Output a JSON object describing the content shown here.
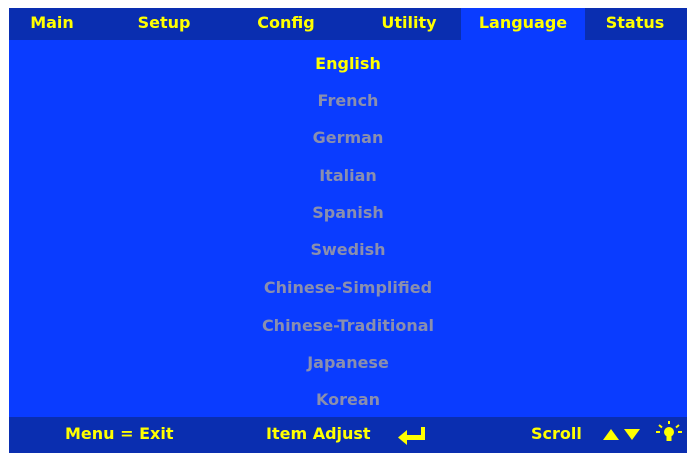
{
  "colors": {
    "panel": "#0a3cff",
    "bar": "#0a2eb0",
    "accent": "#ffff00",
    "inactive": "#8a8fae"
  },
  "tabs": [
    {
      "label": "Main"
    },
    {
      "label": "Setup"
    },
    {
      "label": "Config"
    },
    {
      "label": "Utility"
    },
    {
      "label": "Language"
    },
    {
      "label": "Status"
    }
  ],
  "active_tab": "Language",
  "languages": [
    {
      "label": "English"
    },
    {
      "label": "French"
    },
    {
      "label": "German"
    },
    {
      "label": "Italian"
    },
    {
      "label": "Spanish"
    },
    {
      "label": "Swedish"
    },
    {
      "label": "Chinese-Simplified"
    },
    {
      "label": "Chinese-Traditional"
    },
    {
      "label": "Japanese"
    },
    {
      "label": "Korean"
    }
  ],
  "selected_language": "English",
  "footer": {
    "exit_hint": "Menu = Exit",
    "adjust_hint": "Item Adjust",
    "scroll_hint": "Scroll",
    "icons": [
      "enter-arrow-icon",
      "up-down-arrows-icon",
      "lamp-icon"
    ]
  }
}
